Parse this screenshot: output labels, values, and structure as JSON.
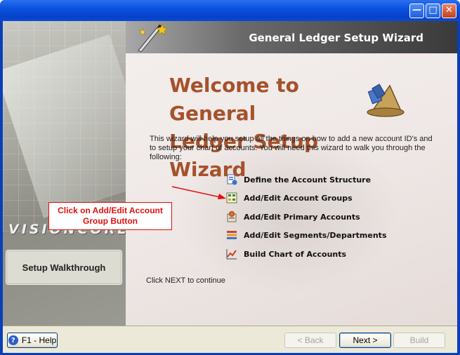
{
  "window": {
    "minimize_icon": "minimize-icon",
    "maximize_icon": "maximize-icon",
    "close_icon": "close-icon"
  },
  "sidebar": {
    "brand": "VISIONCORE",
    "walkthrough_label": "Setup Walkthrough"
  },
  "banner": {
    "title": "General Ledger Setup Wizard"
  },
  "main": {
    "welcome_line1": "Welcome to General",
    "welcome_line2": "Ledger Setup Wizard",
    "description": "This wizard will help you setup all the things on how to add a new account ID's and to setup your chart of accounts. You will need this wizard to walk you through the following:",
    "items": [
      {
        "label": "Define the Account Structure",
        "icon": "account-structure-icon"
      },
      {
        "label": "Add/Edit Account Groups",
        "icon": "account-groups-icon"
      },
      {
        "label": "Add/Edit Primary Accounts",
        "icon": "primary-accounts-icon"
      },
      {
        "label": "Add/Edit Segments/Departments",
        "icon": "segments-icon"
      },
      {
        "label": "Build Chart of Accounts",
        "icon": "chart-of-accounts-icon"
      }
    ],
    "continue_text": "Click NEXT to continue"
  },
  "callout": {
    "line1": "Click on Add/Edit Account",
    "line2": "Group Button",
    "color": "#e01010"
  },
  "footer": {
    "help_label": "F1 - Help",
    "back_label": "< Back",
    "next_label": "Next >",
    "build_label": "Build"
  },
  "colors": {
    "title_bar": "#0a52e0",
    "welcome_text": "#a5522b",
    "banner_dark": "#3a3a3a"
  }
}
